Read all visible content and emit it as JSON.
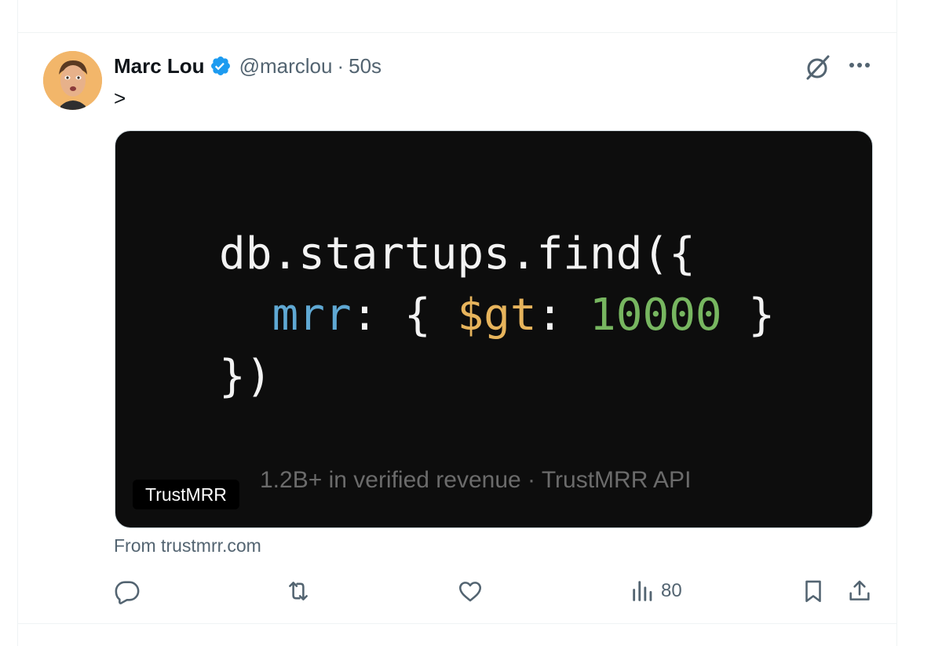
{
  "post": {
    "author_name": "Marc Lou",
    "author_handle": "@marclou",
    "separator": "·",
    "timestamp": "50s",
    "text": ">",
    "verified_icon": "verified-badge-icon",
    "avatar_icon": "avatar-photo"
  },
  "card": {
    "code_line1": "db.startups.find({",
    "code_indent": "  ",
    "code_key": "mrr",
    "code_colon": ": { ",
    "code_operator": "$gt",
    "code_colon2": ": ",
    "code_value": "10000",
    "code_close": " }",
    "code_line3": "})",
    "footer_text": "1.2B+ in verified revenue · TrustMRR API",
    "label": "TrustMRR",
    "source": "From trustmrr.com"
  },
  "actions": {
    "reply_icon": "reply-icon",
    "repost_icon": "repost-icon",
    "like_icon": "heart-icon",
    "views_icon": "views-chart-icon",
    "views_count": "80",
    "bookmark_icon": "bookmark-icon",
    "share_icon": "share-icon"
  },
  "colors": {
    "accent": "#1d9bf0",
    "secondary_text": "#536471",
    "code_key": "#5fa8d3",
    "code_operator": "#e7b45c",
    "code_number": "#77b660"
  }
}
